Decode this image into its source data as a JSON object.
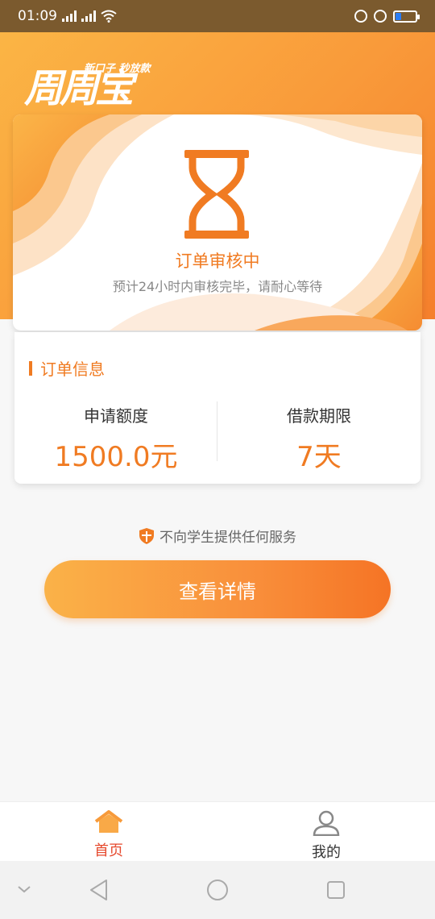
{
  "status_bar": {
    "time": "01:09"
  },
  "header": {
    "logo_text": "周周宝",
    "slogan": "新口子 秒放款"
  },
  "status_card": {
    "title": "订单审核中",
    "description": "预计24小时内审核完毕，请耐心等待"
  },
  "info": {
    "heading": "订单信息",
    "amount_label": "申请额度",
    "amount_value": "1500.0元",
    "term_label": "借款期限",
    "term_value": "7天"
  },
  "notice": "不向学生提供任何服务",
  "cta_label": "查看详情",
  "tabs": [
    {
      "label": "首页"
    },
    {
      "label": "我的"
    }
  ],
  "colors": {
    "accent": "#f07b22",
    "active_tab": "#e64a2e"
  },
  "icons": [
    "hourglass-icon",
    "shield-icon",
    "home-icon",
    "user-icon",
    "back-icon",
    "home-nav-icon",
    "recent-apps-icon"
  ]
}
